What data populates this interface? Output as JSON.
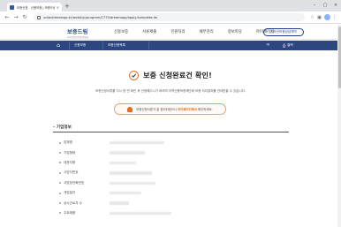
{
  "browser": {
    "tab_title": "보증신청 - 신용보증 | 보증드림",
    "tab_close": "×",
    "new_tab": "+",
    "url": "untactdreamgo.kr/web/k/p/program/C775/dreamapp/apply/complete.do",
    "window_buttons": [
      "–",
      "▢",
      "×"
    ]
  },
  "site": {
    "logo_main": "보증드림",
    "logo_sub": "지역신용보증재단중앙회",
    "nav": [
      "신용보증",
      "서류제출",
      "민원처리",
      "채무관리",
      "정보마당",
      "마이페이지"
    ],
    "cta": "온라인보증상담예약"
  },
  "locbar": {
    "crumbs": [
      "신용보증",
      "보증신청목록"
    ],
    "print_label": "출력"
  },
  "main": {
    "title": "보증 신청완료건 확인!",
    "description": "보증신청서류를 다시 한 번 확인 후 신청해주시기 바라며 지역신용보증재단에 보증 처리결과를 안내받을 수 있습니다.",
    "notice_prefix": "보증신청서류가 잘 정리되었으니 ",
    "notice_highlight": "마이페이지에서",
    "notice_suffix": " 확인하세요."
  },
  "company_section": {
    "title": "기업정보",
    "rows": [
      {
        "label": "업체명"
      },
      {
        "label": "기업형태"
      },
      {
        "label": "대표자명"
      },
      {
        "label": "사업자번호"
      },
      {
        "label": "사업장전화번호"
      },
      {
        "label": "개업일자"
      },
      {
        "label": "상시근로자 수"
      },
      {
        "label": "주요제품"
      }
    ]
  },
  "colors": {
    "brand": "#1f3f8a",
    "locbar": "#2d4680",
    "accent": "#e07a2b"
  }
}
